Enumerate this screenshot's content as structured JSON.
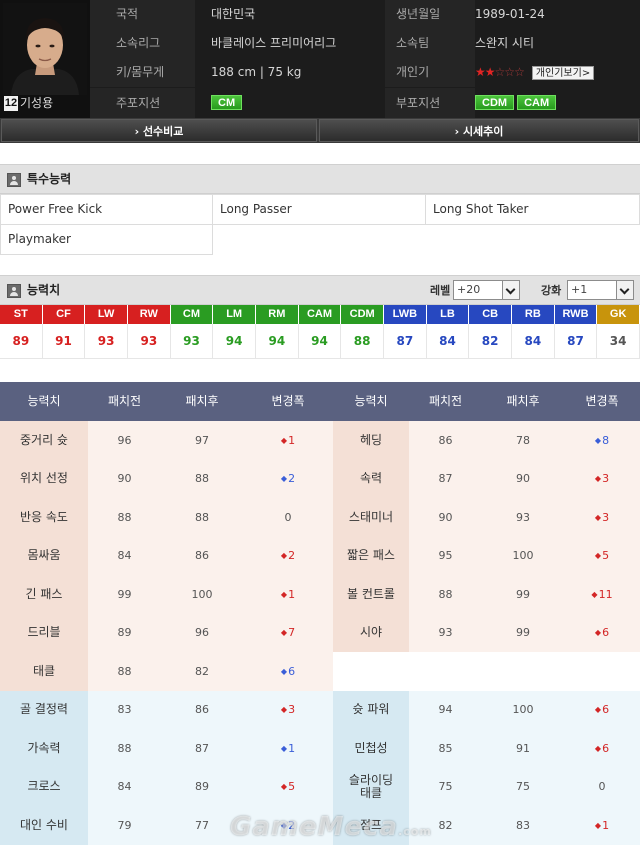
{
  "player": {
    "name": "기성용",
    "number": "12",
    "info": [
      {
        "label": "국적",
        "value": "대한민국",
        "label2": "생년월일",
        "value2": "1989-01-24"
      },
      {
        "label": "소속리그",
        "value": "바클레이스 프리미어리그",
        "label2": "소속팀",
        "value2": "스완지 시티"
      },
      {
        "label": "키/몸무게",
        "value": "188 cm | 75 kg",
        "label2": "개인기",
        "value2": ""
      },
      {
        "label": "주포지션",
        "value": "",
        "label2": "부포지션",
        "value2": ""
      }
    ],
    "skill_stars": {
      "filled": 2,
      "total": 5,
      "button": "개인기보기>"
    },
    "main_positions": [
      "CM"
    ],
    "sub_positions": [
      "CDM",
      "CAM"
    ]
  },
  "compare_bar": {
    "left": "› 선수비교",
    "right": "› 시세추이"
  },
  "traits_section": {
    "title": "특수능력",
    "items": [
      "Power Free Kick",
      "Long Passer",
      "Long Shot Taker",
      "Playmaker"
    ]
  },
  "ability_section": {
    "title": "능력치",
    "level_label": "레벨",
    "level_value": "+20",
    "enhance_label": "강화",
    "enhance_value": "+1"
  },
  "positions": [
    {
      "code": "ST",
      "value": "89"
    },
    {
      "code": "CF",
      "value": "91"
    },
    {
      "code": "LW",
      "value": "93"
    },
    {
      "code": "RW",
      "value": "93"
    },
    {
      "code": "CM",
      "value": "93"
    },
    {
      "code": "LM",
      "value": "94"
    },
    {
      "code": "RM",
      "value": "94"
    },
    {
      "code": "CAM",
      "value": "94"
    },
    {
      "code": "CDM",
      "value": "88"
    },
    {
      "code": "LWB",
      "value": "87"
    },
    {
      "code": "LB",
      "value": "84"
    },
    {
      "code": "CB",
      "value": "82"
    },
    {
      "code": "RB",
      "value": "84"
    },
    {
      "code": "RWB",
      "value": "87"
    },
    {
      "code": "GK",
      "value": "34"
    }
  ],
  "colors": {
    "attack": "#d72020",
    "mid": "#2a9c22",
    "def": "#2748c0",
    "gk": "#c8940c",
    "header_bg": "#1c1c1c",
    "stats_head": "#5a6180"
  },
  "stats": {
    "headers": [
      "능력치",
      "패치전",
      "패치후",
      "변경폭",
      "능력치",
      "패치전",
      "패치후",
      "변경폭"
    ],
    "rows": [
      [
        {
          "name": "중거리 슛",
          "before": "96",
          "after": "97",
          "delta": "1",
          "dir": "up"
        },
        {
          "name": "헤딩",
          "before": "86",
          "after": "78",
          "delta": "8",
          "dir": "dn"
        }
      ],
      [
        {
          "name": "위치 선정",
          "before": "90",
          "after": "88",
          "delta": "2",
          "dir": "dn"
        },
        {
          "name": "속력",
          "before": "87",
          "after": "90",
          "delta": "3",
          "dir": "up"
        }
      ],
      [
        {
          "name": "반응 속도",
          "before": "88",
          "after": "88",
          "delta": "0",
          "dir": "none"
        },
        {
          "name": "스태미너",
          "before": "90",
          "after": "93",
          "delta": "3",
          "dir": "up"
        }
      ],
      [
        {
          "name": "몸싸움",
          "before": "84",
          "after": "86",
          "delta": "2",
          "dir": "up"
        },
        {
          "name": "짧은 패스",
          "before": "95",
          "after": "100",
          "delta": "5",
          "dir": "up"
        }
      ],
      [
        {
          "name": "긴 패스",
          "before": "99",
          "after": "100",
          "delta": "1",
          "dir": "up"
        },
        {
          "name": "볼 컨트롤",
          "before": "88",
          "after": "99",
          "delta": "11",
          "dir": "up"
        }
      ],
      [
        {
          "name": "드리블",
          "before": "89",
          "after": "96",
          "delta": "7",
          "dir": "up"
        },
        {
          "name": "시야",
          "before": "93",
          "after": "99",
          "delta": "6",
          "dir": "up"
        }
      ],
      [
        {
          "name": "태클",
          "before": "88",
          "after": "82",
          "delta": "6",
          "dir": "dn"
        },
        null
      ],
      [
        {
          "name": "골 결정력",
          "before": "83",
          "after": "86",
          "delta": "3",
          "dir": "up"
        },
        {
          "name": "슛 파워",
          "before": "94",
          "after": "100",
          "delta": "6",
          "dir": "up"
        }
      ],
      [
        {
          "name": "가속력",
          "before": "88",
          "after": "87",
          "delta": "1",
          "dir": "dn"
        },
        {
          "name": "민첩성",
          "before": "85",
          "after": "91",
          "delta": "6",
          "dir": "up"
        }
      ],
      [
        {
          "name": "크로스",
          "before": "84",
          "after": "89",
          "delta": "5",
          "dir": "up"
        },
        {
          "name": "슬라이딩\n태클",
          "before": "75",
          "after": "75",
          "delta": "0",
          "dir": "none"
        }
      ],
      [
        {
          "name": "대인 수비",
          "before": "79",
          "after": "77",
          "delta": "2",
          "dir": "dn"
        },
        {
          "name": "점프",
          "before": "82",
          "after": "83",
          "delta": "1",
          "dir": "up"
        }
      ]
    ]
  },
  "watermark": {
    "main": "GameMeca",
    "suffix": ".com"
  }
}
